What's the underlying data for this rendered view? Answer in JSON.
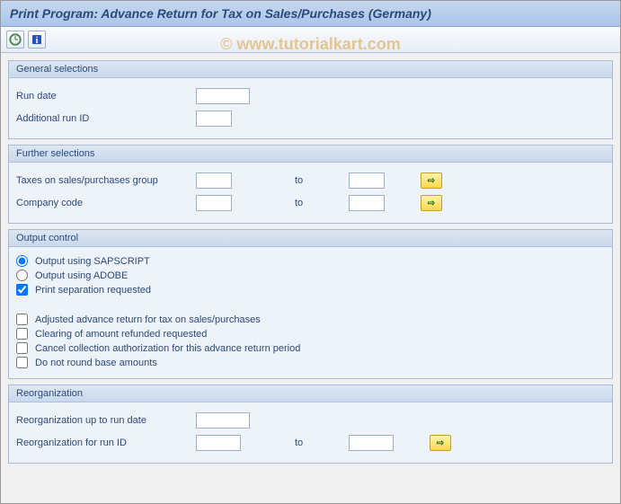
{
  "title": "Print Program: Advance Return for Tax on Sales/Purchases (Germany)",
  "watermark": "© www.tutorialkart.com",
  "toolbar": {
    "execute_title": "Execute",
    "info_title": "Information"
  },
  "panels": {
    "general": {
      "title": "General selections",
      "run_date_label": "Run date",
      "additional_run_id_label": "Additional run ID"
    },
    "further": {
      "title": "Further selections",
      "tax_group_label": "Taxes on sales/purchases group",
      "company_code_label": "Company code",
      "to_label": "to"
    },
    "output": {
      "title": "Output control",
      "sapscript_label": "Output using SAPSCRIPT",
      "adobe_label": "Output using ADOBE",
      "print_sep_label": "Print separation requested",
      "adjusted_label": "Adjusted advance return for tax on sales/purchases",
      "clearing_label": "Clearing of amount refunded requested",
      "cancel_auth_label": "Cancel collection authorization for this advance return period",
      "no_round_label": "Do not round base amounts"
    },
    "reorg": {
      "title": "Reorganization",
      "up_to_date_label": "Reorganization up to run date",
      "run_id_label": "Reorganization for run ID",
      "to_label": "to"
    }
  },
  "values": {
    "run_date": "",
    "additional_run_id": "",
    "tax_group_from": "",
    "tax_group_to": "",
    "company_code_from": "",
    "company_code_to": "",
    "output_mode": "sapscript",
    "print_sep": true,
    "adjusted": false,
    "clearing": false,
    "cancel_auth": false,
    "no_round": false,
    "reorg_date": "",
    "reorg_id_from": "",
    "reorg_id_to": ""
  }
}
